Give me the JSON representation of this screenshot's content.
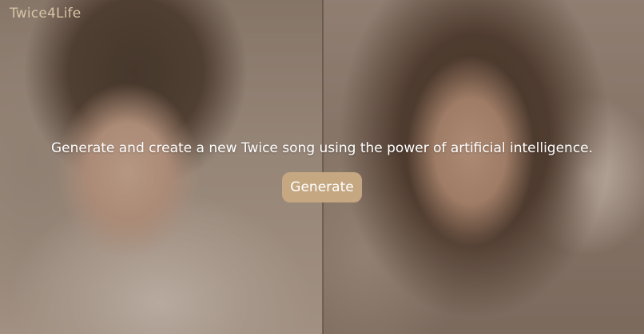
{
  "brand": {
    "name": "Twice4Life"
  },
  "hero": {
    "description": "Generate and create a new Twice song using the power of artificial intelligence.",
    "button_label": "Generate"
  },
  "colors": {
    "brand_text": "#d8c3a5",
    "button_bg": "#c5a882",
    "button_text": "#ffffff",
    "hero_text": "#ffffff"
  }
}
